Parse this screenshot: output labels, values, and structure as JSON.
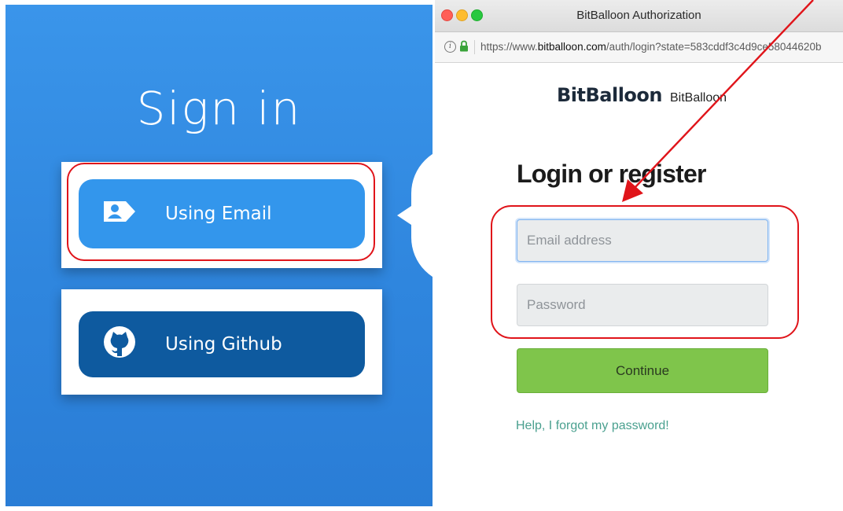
{
  "signin_panel": {
    "title": "Sign in",
    "email_button_label": "Using Email",
    "github_button_label": "Using Github"
  },
  "browser": {
    "window_title": "BitBalloon Authorization",
    "url_prefix": "https://www.",
    "url_host": "bitballoon.com",
    "url_path": "/auth/login?state=583cddf3c4d9ce58044620b"
  },
  "page": {
    "brand_logo": "BitBalloon",
    "brand_name": "BitBalloon",
    "heading": "Login or register",
    "email_placeholder": "Email address",
    "email_value": "",
    "password_placeholder": "Password",
    "password_value": "",
    "continue_label": "Continue",
    "forgot_link": "Help, I forgot my password!"
  },
  "colors": {
    "panel_blue": "#3a95ea",
    "email_button": "#3396ec",
    "github_button": "#0e5a9f",
    "continue_green": "#7fc54b",
    "link_teal": "#4aa08f",
    "annotation_red": "#e0141a"
  },
  "icons": {
    "email_button_icon": "user-tag-icon",
    "github_button_icon": "github-icon",
    "security_icons": [
      "info-icon",
      "lock-icon"
    ]
  }
}
